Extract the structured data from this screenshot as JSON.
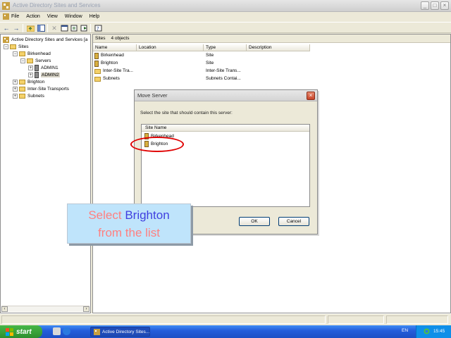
{
  "window": {
    "title": "Active Directory Sites and Services",
    "buttons": {
      "minimize": "_",
      "maximize": "□",
      "close": "×"
    }
  },
  "menu": [
    "File",
    "Action",
    "View",
    "Window",
    "Help"
  ],
  "toolbar": {
    "icons": [
      "back-icon",
      "forward-icon",
      "up-icon",
      "show-hide-tree-icon",
      "delete-icon",
      "properties-icon",
      "refresh-icon",
      "export-icon",
      "help-icon"
    ]
  },
  "tree": {
    "root": "Active Directory Sites and Services [a",
    "sites": "Sites",
    "birkenhead": "Birkenhead",
    "servers": "Servers",
    "admin1": "ADMIN1",
    "admin2": "ADMIN2",
    "brighton": "Brighton",
    "inter_site": "Inter-Site Transports",
    "subnets": "Subnets",
    "expand_plus": "+",
    "expand_minus": "−"
  },
  "rightpane": {
    "header_title": "Sites",
    "header_count": "4 objects",
    "columns": [
      "Name",
      "Location",
      "Type",
      "Description"
    ],
    "rows": [
      {
        "name": "Birkenhead",
        "location": "",
        "type": "Site",
        "description": ""
      },
      {
        "name": "Brighton",
        "location": "",
        "type": "Site",
        "description": ""
      },
      {
        "name": "Inter-Site Tra...",
        "location": "",
        "type": "Inter-Site Trans...",
        "description": ""
      },
      {
        "name": "Subnets",
        "location": "",
        "type": "Subnets Contai...",
        "description": ""
      }
    ]
  },
  "dialog": {
    "title": "Move Server",
    "close": "×",
    "prompt": "Select the site that should contain this server:",
    "list_header": "Site Name",
    "items": [
      "Birkenhead",
      "Brighton"
    ],
    "ok": "OK",
    "cancel": "Cancel"
  },
  "callout": {
    "word1": "Select",
    "word2": "Brighton",
    "line2": "from the list"
  },
  "taskbar": {
    "start": "start",
    "task": "Active Directory Sites...",
    "lang": "EN",
    "clock": "15:45"
  },
  "colors": {
    "highlight_ellipse": "#e00000",
    "callout_bg": "#bfe4fb",
    "callout_text": "#ff8080",
    "callout_accent": "#4040e0",
    "taskbar": "#245edc",
    "start_button": "#3a9f3a"
  }
}
